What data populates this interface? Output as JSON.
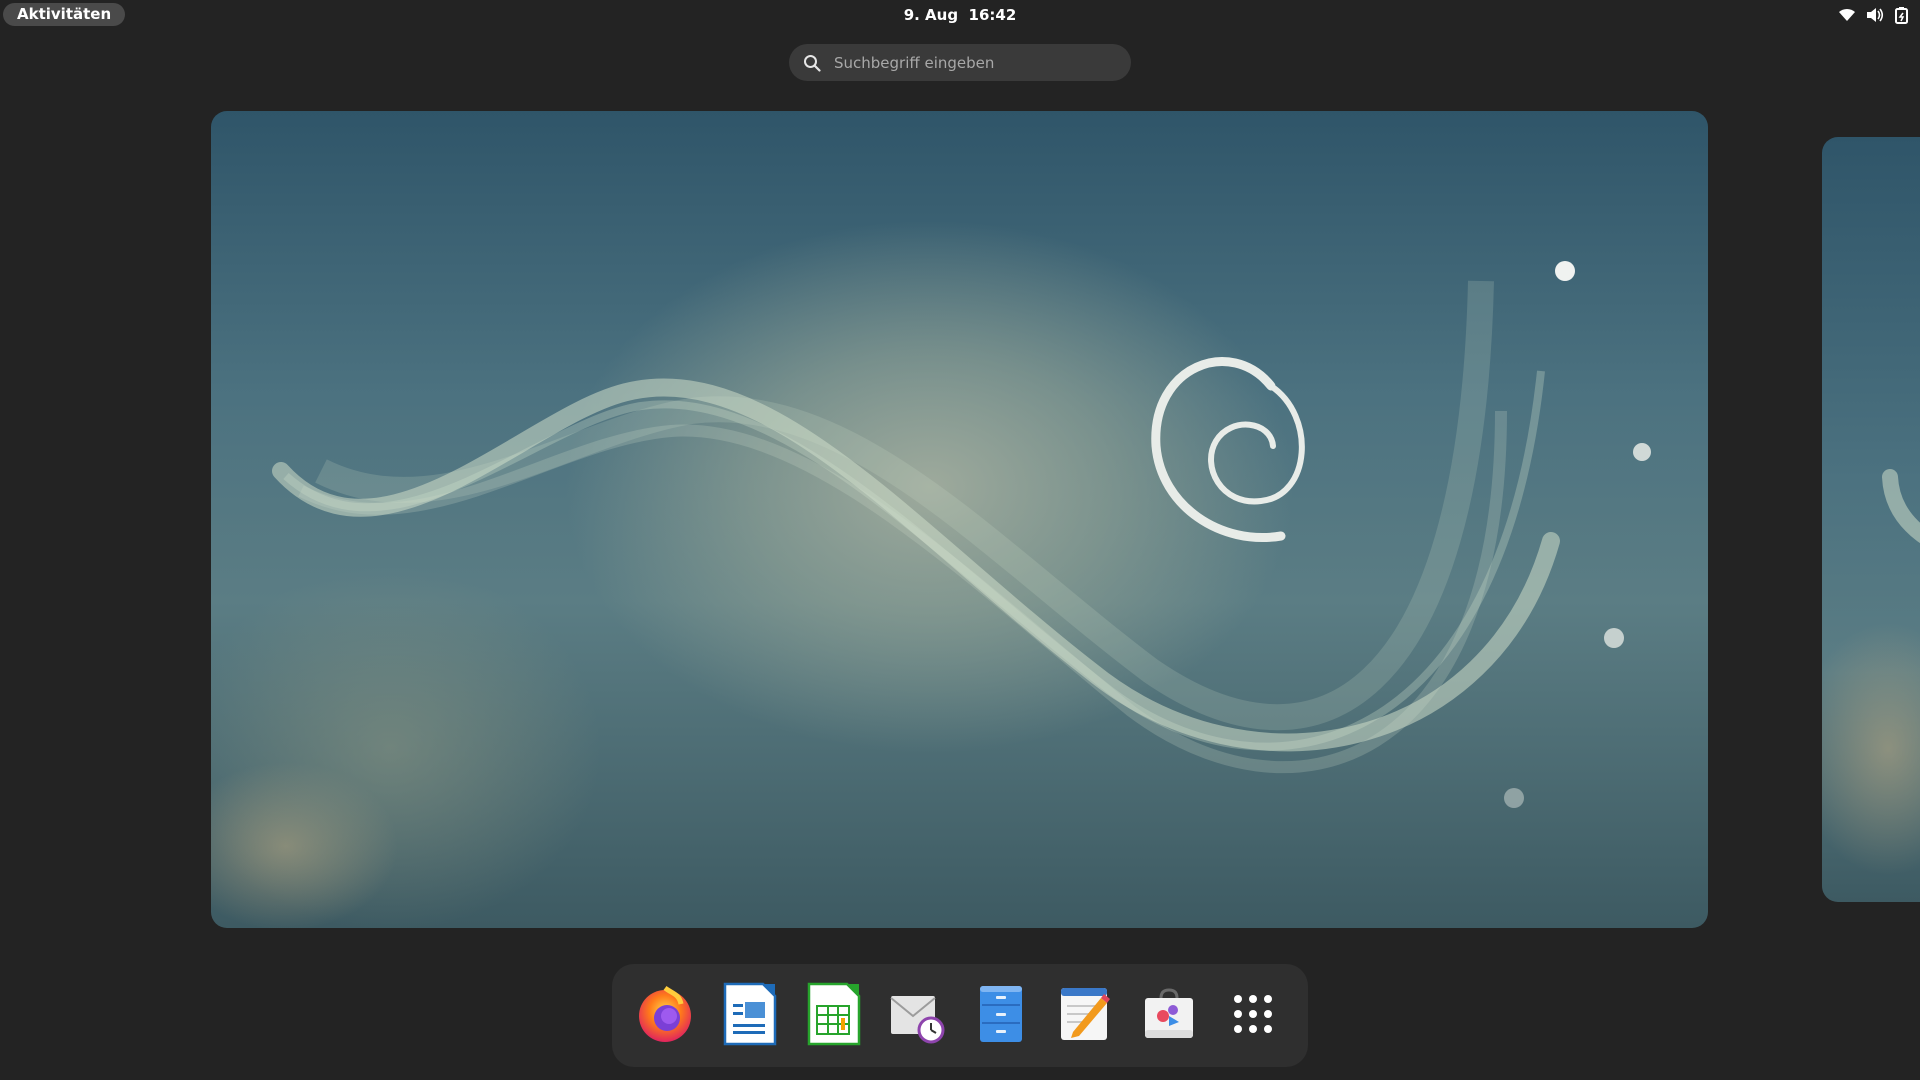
{
  "topbar": {
    "activities_label": "Aktivitäten",
    "date": "9. Aug",
    "time": "16:42",
    "status_icons": [
      "wifi-icon",
      "volume-icon",
      "power-icon"
    ]
  },
  "search": {
    "placeholder": "Suchbegriff eingeben"
  },
  "dock": {
    "items": [
      {
        "name": "Firefox",
        "icon": "firefox-icon"
      },
      {
        "name": "LibreOffice Writer",
        "icon": "writer-icon"
      },
      {
        "name": "LibreOffice Calc",
        "icon": "calc-icon"
      },
      {
        "name": "Evolution",
        "icon": "mail-clock-icon"
      },
      {
        "name": "Dateien",
        "icon": "files-icon"
      },
      {
        "name": "Texteditor",
        "icon": "text-editor-icon"
      },
      {
        "name": "Software",
        "icon": "software-store-icon"
      },
      {
        "name": "Anwendungen anzeigen",
        "icon": "app-grid-icon"
      }
    ]
  },
  "colors": {
    "background": "#232323",
    "panel": "#2f2f2f",
    "search_bg": "#3a3a3a"
  }
}
